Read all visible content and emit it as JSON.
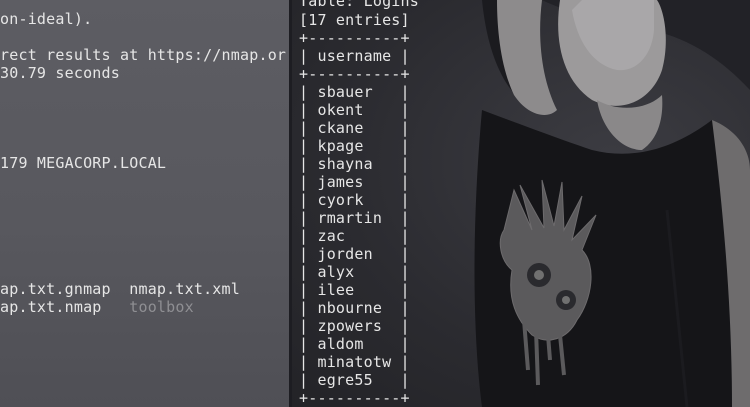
{
  "left_terminal": {
    "lines": [
      "on-ideal).",
      "",
      "rect results at https://nmap.or",
      "30.79 seconds",
      "",
      "",
      "",
      "",
      "",
      "179 MEGACORP.LOCAL",
      "",
      "",
      "",
      "",
      "",
      "",
      "ap.txt.gnmap  nmap.txt.xml",
      "ap.txt.nmap   "
    ],
    "toolbox_entry": "toolbox"
  },
  "right_terminal": {
    "table_header": "Table: Logins",
    "entries_count": "[17 entries]",
    "border_line": "+----------+",
    "column_header": "| username |",
    "rows": [
      "| sbauer   |",
      "| okent    |",
      "| ckane    |",
      "| kpage    |",
      "| shayna   |",
      "| james    |",
      "| cyork    |",
      "| rmartin  |",
      "| zac      |",
      "| jorden   |",
      "| alyx     |",
      "| ilee     |",
      "| nbourne  |",
      "| zpowers  |",
      "| aldom    |",
      "| minatotw |",
      "| egre55   |"
    ]
  },
  "colors": {
    "terminal_text": "#e6e6e6",
    "dim_text": "#8f8f93",
    "left_background": "#5a5a60",
    "right_background": "#2e2e33"
  },
  "icons": [
    "wallpaper-graphic"
  ]
}
